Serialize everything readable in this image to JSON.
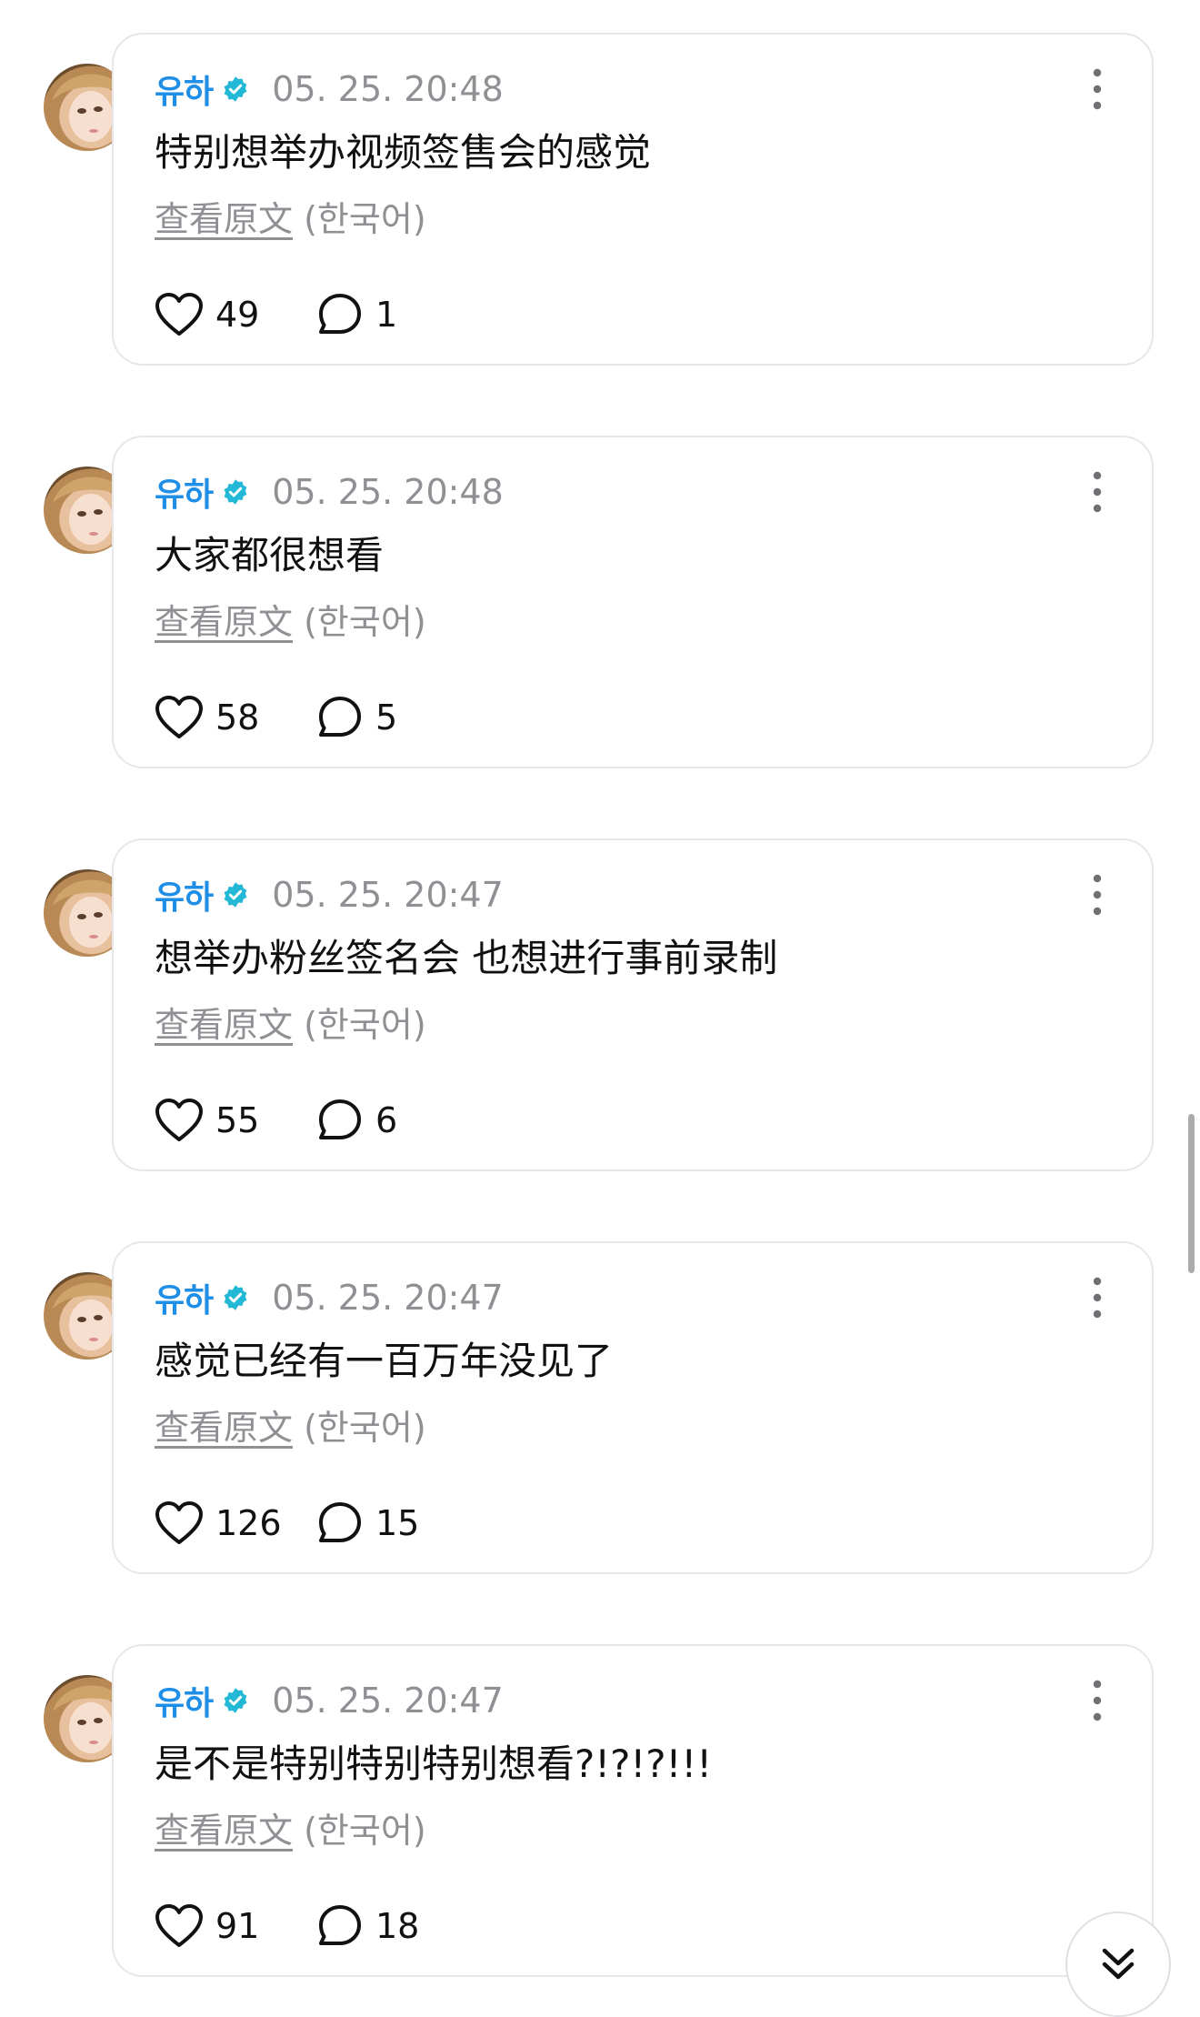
{
  "feed": {
    "posts": [
      {
        "author": "유하",
        "time": "05. 25. 20:48",
        "text": "特别想举办视频签售会的感觉",
        "translate_link": "查看原文",
        "translate_lang": "(한국어)",
        "likes": "49",
        "comments": "1"
      },
      {
        "author": "유하",
        "time": "05. 25. 20:48",
        "text": "大家都很想看",
        "translate_link": "查看原文",
        "translate_lang": "(한국어)",
        "likes": "58",
        "comments": "5"
      },
      {
        "author": "유하",
        "time": "05. 25. 20:47",
        "text": "想举办粉丝签名会 也想进行事前录制",
        "translate_link": "查看原文",
        "translate_lang": "(한국어)",
        "likes": "55",
        "comments": "6"
      },
      {
        "author": "유하",
        "time": "05. 25. 20:47",
        "text": "感觉已经有一百万年没见了",
        "translate_link": "查看原文",
        "translate_lang": "(한국어)",
        "likes": "126",
        "comments": "15"
      },
      {
        "author": "유하",
        "time": "05. 25. 20:47",
        "text": "是不是特别特别特别想看?!?!?!!!",
        "translate_link": "查看原文",
        "translate_lang": "(한국어)",
        "likes": "91",
        "comments": "18"
      }
    ]
  },
  "icons": {
    "verified": "verified-badge-icon",
    "more": "more-vertical-icon",
    "like": "heart-icon",
    "comment": "comment-bubble-icon",
    "scroll_down": "double-chevron-down-icon"
  },
  "colors": {
    "author": "#1e8ee6",
    "verified_badge": "#22b8d6",
    "meta_gray": "#8e9094",
    "card_border": "#e7e7ea"
  }
}
